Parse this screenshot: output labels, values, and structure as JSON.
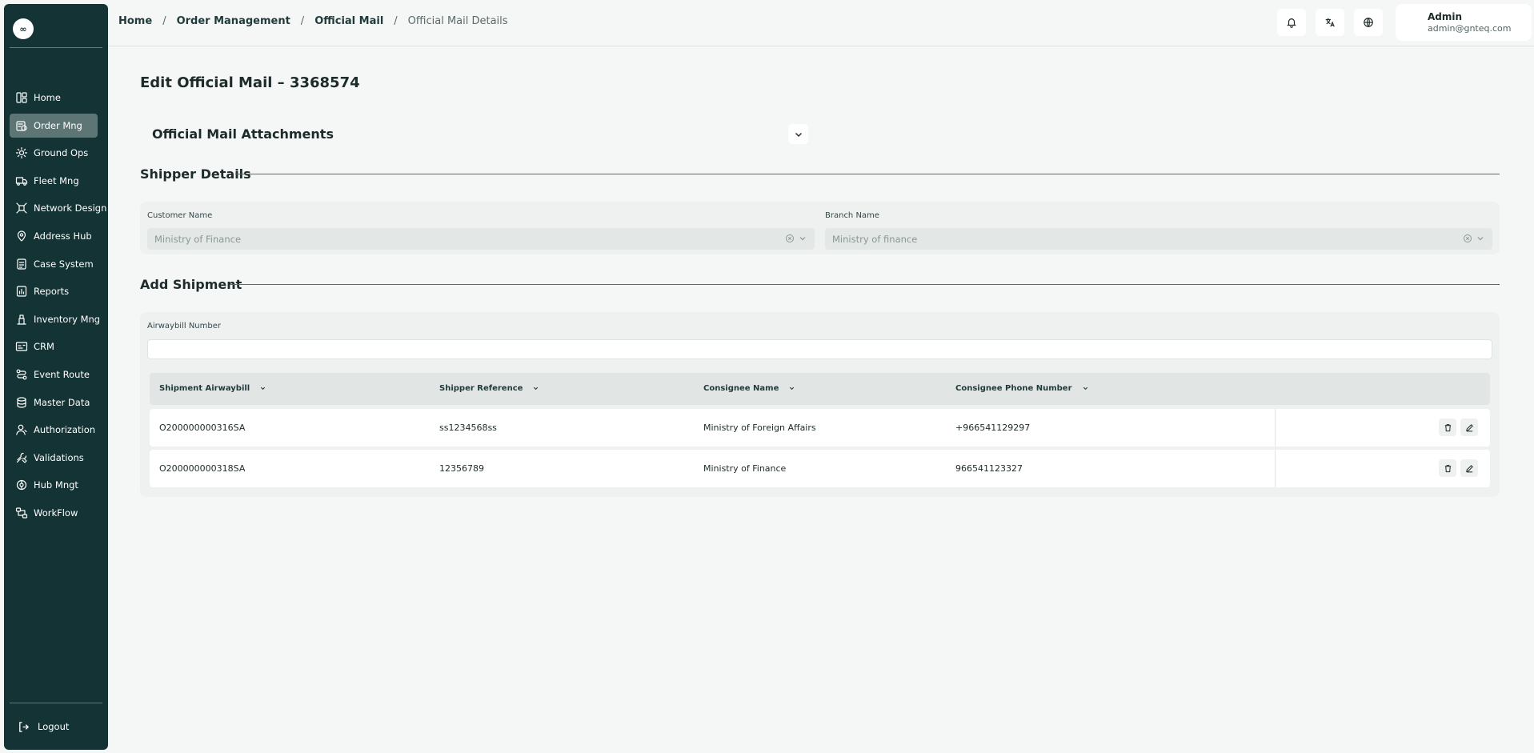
{
  "sidebar": {
    "logo_text": "∞",
    "items": [
      {
        "label": "Home",
        "icon": "layout-icon",
        "active": false
      },
      {
        "label": "Order Mng",
        "icon": "order-icon",
        "active": true
      },
      {
        "label": "Ground Ops",
        "icon": "ground-icon",
        "active": false
      },
      {
        "label": "Fleet Mng",
        "icon": "truck-icon",
        "active": false
      },
      {
        "label": "Network Design",
        "icon": "network-icon",
        "active": false
      },
      {
        "label": "Address Hub",
        "icon": "map-pin-icon",
        "active": false
      },
      {
        "label": "Case System",
        "icon": "case-icon",
        "active": false
      },
      {
        "label": "Reports",
        "icon": "report-icon",
        "active": false
      },
      {
        "label": "Inventory Mng",
        "icon": "inventory-icon",
        "active": false
      },
      {
        "label": "CRM",
        "icon": "crm-icon",
        "active": false
      },
      {
        "label": "Event Route",
        "icon": "route-icon",
        "active": false
      },
      {
        "label": "Master Data",
        "icon": "database-icon",
        "active": false
      },
      {
        "label": "Authorization",
        "icon": "user-icon",
        "active": false
      },
      {
        "label": "Validations",
        "icon": "tools-icon",
        "active": false
      },
      {
        "label": "Hub Mngt",
        "icon": "hub-icon",
        "active": false
      },
      {
        "label": "WorkFlow",
        "icon": "workflow-icon",
        "active": false
      }
    ],
    "logout_label": "Logout"
  },
  "header": {
    "breadcrumb": [
      "Home",
      "Order Management",
      "Official Mail",
      "Official Mail Details"
    ],
    "breadcrumb_separator": "/",
    "user_name": "Admin",
    "user_email": "admin@gnteq.com"
  },
  "page": {
    "title": "Edit Official Mail – 3368574",
    "attachments_title": "Official Mail Attachments"
  },
  "shipper": {
    "section_title": "Shipper Details",
    "customer_label": "Customer Name",
    "customer_value": "Ministry of Finance",
    "branch_label": "Branch Name",
    "branch_value": "Ministry of finance"
  },
  "shipment": {
    "section_title": "Add Shipment",
    "awb_label": "Airwaybill Number",
    "awb_value": "",
    "columns": [
      "Shipment Airwaybill",
      "Shipper Reference",
      "Consignee Name",
      "Consignee Phone Number"
    ],
    "rows": [
      [
        "O200000000316SA",
        "ss1234568ss",
        "Ministry of Foreign Affairs",
        "+966541129297"
      ],
      [
        "O200000000318SA",
        "12356789",
        "Ministry of Finance",
        "966541123327"
      ]
    ]
  },
  "colors": {
    "sidebar_bg": "#133334",
    "sidebar_active": "#5d7575",
    "accent_line": "#3f7478",
    "page_bg": "#f5f7f6"
  }
}
